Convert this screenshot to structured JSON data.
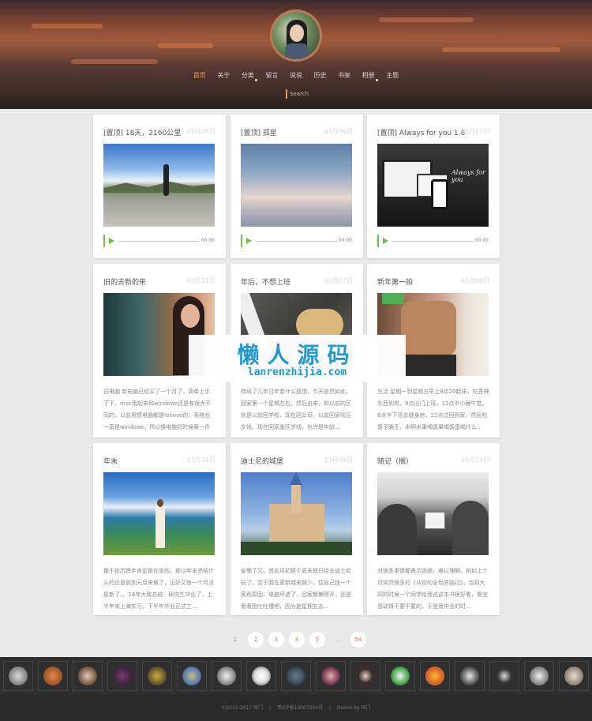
{
  "nav": {
    "items": [
      "首页",
      "关于",
      "分类",
      "留言",
      "说说",
      "历史",
      "书架",
      "相册",
      "主题"
    ],
    "active": 0
  },
  "search": {
    "placeholder": "Search"
  },
  "posts": [
    {
      "title": "[置顶] 18天，2160公里",
      "date": "05月06日",
      "image": "road-landscape",
      "audio_time": "00:00"
    },
    {
      "title": "[置顶] 孤星",
      "date": "04月06日",
      "image": "cloud-sea",
      "audio_time": "00:00"
    },
    {
      "title": "[置顶] Always for you 1.8",
      "date": "08月17日",
      "image": "theme-devices",
      "audio_time": "00:00"
    },
    {
      "title": "旧的去新的来",
      "date": "02月11日",
      "image": "girl-portrait",
      "excerpt": "旧电脑 新电脑已经买了一个月了，简单上手了下，mac用起来和windows还是有很大不同的，以前用惯电脑都是lenovo的，系统也一直是windows，所以换电脑好时候第一件事就..."
    },
    {
      "title": "年后，不想上班",
      "date": "02月07日",
      "image": "bread-hand",
      "excerpt": "持续了几年过年变什么感觉，今天依然如此，回家第一个星期左右，然后出来，和以前的区别是以前回学校，现在回公司，以前回家吹压岁钱，现在回家发压岁钱，也许是年龄..."
    },
    {
      "title": "新年第一拍",
      "date": "01月06日",
      "image": "fitness-photo",
      "excerpt": "生活 星期一到星期五早上8点20起床，吃吾神东西到岗，9点出门上班，12点半小睡午觉，6点半下班去健身房，22点过回到家，然后吃饭子晚王，米啊水果喝饭果喝饭蛋喝什么..."
    },
    {
      "title": "年末",
      "date": "12月31日",
      "image": "lake-girl",
      "excerpt": "整于依历跨年肯定是在家的，那以年末总结什么的还是放到元旦来做了，正好又有一个月没更新了。。16年大致总结：研究生毕业了，上半年来上海实习，下半年毕业正式工..."
    },
    {
      "title": "迪士尼的城堡",
      "date": "11月09日",
      "image": "castle",
      "excerpt": "偷懒了又，其实月初那个周末就已经去迪士尼玩了，至于我在更新越来越少，估自己找一个客观原因：电脑坏透了，回家都懒得开，还是看看图吐吐槽吧，因为是星期五去..."
    },
    {
      "title": "随记（搁）",
      "date": "10月24日",
      "image": "bw-village",
      "excerpt": "对很多事情都表示困惑，难以理解，例如上个月突然很多的《从你的全世界路过》，当初大四的时候一个同学给我说这本书很好看，看完感动得不要不要的。于是我毕业的时..."
    }
  ],
  "watermark": {
    "line1": "懒人源码",
    "line2": "lanrenzhijia.com"
  },
  "pagination": [
    "1",
    "2",
    "3",
    "4",
    "5",
    "...",
    "54"
  ],
  "friends": [
    "friend-avatar-1",
    "friend-avatar-2",
    "friend-avatar-3",
    "friend-avatar-4",
    "friend-avatar-5",
    "friend-avatar-6",
    "friend-avatar-7",
    "friend-avatar-8",
    "friend-avatar-9",
    "friend-avatar-10",
    "friend-avatar-11",
    "friend-avatar-12",
    "friend-avatar-13",
    "friend-avatar-14",
    "friend-avatar-15",
    "friend-avatar-16",
    "friend-avatar-17"
  ],
  "footer": {
    "copyright": "©2011-2017 碎门",
    "sep1": "|",
    "icp": "粤ICP备13007254号",
    "sep2": "|",
    "theme": "theme by 碎门"
  },
  "colors": {
    "accent": "#e2a25a",
    "player": "#6cc04a",
    "page_link": "#e06a5a",
    "watermark": "#1f9ad6"
  }
}
